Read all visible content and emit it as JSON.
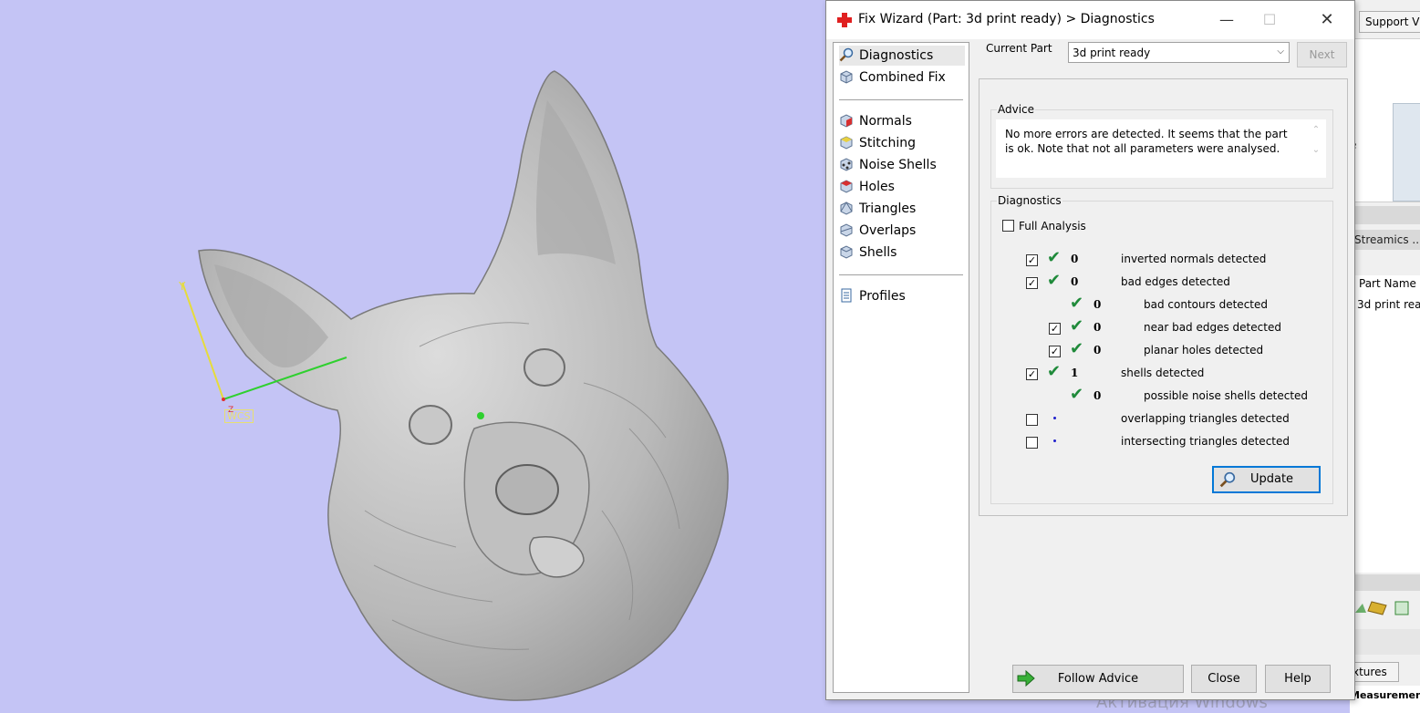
{
  "dialog": {
    "title": "Fix Wizard (Part: 3d print ready) > Diagnostics",
    "minimize_glyph": "—",
    "maximize_glyph": "☐",
    "close_glyph": "✕"
  },
  "nav": {
    "items": [
      {
        "label": "Diagnostics",
        "icon": "magnifier-icon"
      },
      {
        "label": "Combined Fix",
        "icon": "cube-icon"
      },
      {
        "label": "Normals",
        "icon": "cube-red-icon"
      },
      {
        "label": "Stitching",
        "icon": "cube-yellow-icon"
      },
      {
        "label": "Noise Shells",
        "icon": "dots-cube-icon"
      },
      {
        "label": "Holes",
        "icon": "cube-red-icon"
      },
      {
        "label": "Triangles",
        "icon": "cube-triangle-icon"
      },
      {
        "label": "Overlaps",
        "icon": "cube-overlap-icon"
      },
      {
        "label": "Shells",
        "icon": "cube-icon"
      },
      {
        "label": "Profiles",
        "icon": "document-icon"
      }
    ]
  },
  "current_part": {
    "label": "Current Part",
    "value": "3d print ready",
    "next_label": "Next"
  },
  "advice": {
    "title": "Advice",
    "text": "No more errors are detected. It seems that the part is ok. Note that not all parameters were analysed."
  },
  "diagnostics": {
    "title": "Diagnostics",
    "full_analysis": "Full Analysis",
    "rows": [
      {
        "checked": true,
        "status": "ok",
        "count": "0",
        "label": "inverted normals detected"
      },
      {
        "checked": true,
        "status": "ok",
        "count": "0",
        "label": "bad edges detected"
      },
      {
        "checked": null,
        "status": "ok",
        "count": "0",
        "label": "bad contours detected"
      },
      {
        "checked": true,
        "status": "ok",
        "count": "0",
        "label": "near bad edges detected"
      },
      {
        "checked": true,
        "status": "ok",
        "count": "0",
        "label": "planar holes detected"
      },
      {
        "checked": true,
        "status": "ok",
        "count": "1",
        "label": "shells detected"
      },
      {
        "checked": null,
        "status": "ok",
        "count": "0",
        "label": "possible noise shells detected"
      },
      {
        "checked": false,
        "status": "none",
        "count": "",
        "label": "overlapping triangles detected"
      },
      {
        "checked": false,
        "status": "none",
        "count": "",
        "label": "intersecting triangles detected"
      }
    ],
    "update_label": "Update"
  },
  "footer": {
    "follow_advice": "Follow Advice",
    "close": "Close",
    "help": "Help"
  },
  "viewport": {
    "wcs_label": "WCS",
    "axis_y": "Y",
    "axis_z": "Z",
    "background": "#c4c4f5"
  },
  "right_app": {
    "tab": "Support Vi",
    "e_char": "e",
    "streamics": "Streamics ..",
    "col_header": "Part Name",
    "cell": "3d print rea",
    "textures_tab": "xtures",
    "bottom_text": "Measurement Pages"
  },
  "watermark": "Активация Windows",
  "colors": {
    "accent": "#0078d7",
    "ok_green": "#1f8a3a",
    "dot_blue": "#2020cc"
  }
}
